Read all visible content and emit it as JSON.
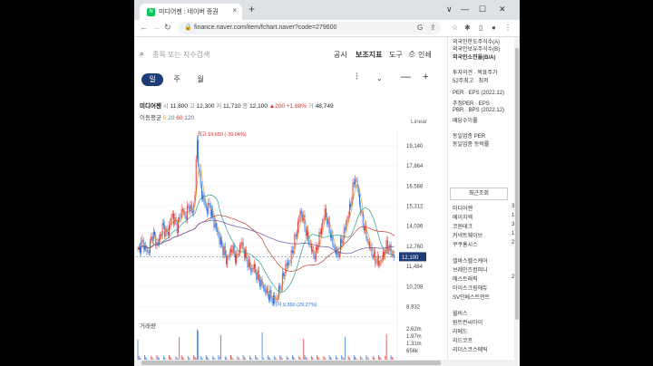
{
  "browser": {
    "tab_title": "미디어젠 : 네이버 증권",
    "tab_favicon": "N",
    "tab_close": "×",
    "new_tab": "+",
    "url": "finance.naver.com/item/fchart.naver?code=279600",
    "window_controls": [
      "∨",
      "—",
      "☐",
      "✕"
    ]
  },
  "search": {
    "placeholder": "종목 또는 지수검색"
  },
  "top_menu": [
    "공시",
    "보조지표",
    "도구",
    "인쇄"
  ],
  "periods": [
    "일",
    "주",
    "월"
  ],
  "stock": {
    "name": "미디어젠",
    "open_label": "시",
    "open": "11,800",
    "high_label": "고",
    "high": "12,300",
    "low_label": "저",
    "low": "11,710",
    "close_label": "종",
    "close": "12,100",
    "change": "▲200 +1.68%",
    "volume_label": "거",
    "volume": "48,749"
  },
  "moving_average": {
    "label": "이동평균",
    "periods": [
      "5",
      "20",
      "60",
      "120"
    ]
  },
  "scale_mode": "Linear",
  "chart_data": {
    "type": "candlestick",
    "price_axis_ticks": [
      "19,140",
      "17,864",
      "16,588",
      "15,312",
      "14,036",
      "12,760",
      "11,484",
      "10,208",
      "8,932"
    ],
    "current_price_tag": "12,100",
    "high_annotation": "최고 19,650 (-39.04%)",
    "low_annotation": "최저 9,360 (29.27%)",
    "volume_label": "거래량",
    "volume_axis_ticks": [
      "2.62m",
      "1.97m",
      "1.31m",
      "656k"
    ],
    "x_ticks": [
      "6월",
      "8월",
      "2022",
      "4월",
      "8월",
      "2023",
      "4월"
    ],
    "ylim": [
      8500,
      20000
    ],
    "price_path": [
      12400,
      12800,
      13000,
      12600,
      12300,
      12900,
      13600,
      13200,
      12800,
      13400,
      14000,
      13800,
      13500,
      14200,
      14800,
      14300,
      14000,
      14600,
      15200,
      14600,
      15000,
      15400,
      14800,
      15600,
      19650,
      17000,
      16000,
      15500,
      15000,
      15400,
      14800,
      14200,
      13800,
      13200,
      12800,
      12400,
      11800,
      12200,
      12700,
      12300,
      11900,
      12600,
      13000,
      12400,
      12000,
      11600,
      11200,
      11500,
      11000,
      10700,
      10400,
      10100,
      9900,
      9700,
      9500,
      9400,
      9360,
      9800,
      10300,
      10900,
      11500,
      11700,
      12000,
      12700,
      13400,
      14200,
      15000,
      14500,
      13800,
      13200,
      12700,
      12300,
      12100,
      13000,
      13600,
      14400,
      15000,
      14200,
      13600,
      12900,
      12500,
      12100,
      12700,
      13300,
      13900,
      14600,
      15200,
      16200,
      17200,
      16500,
      15400,
      14400,
      13800,
      13200,
      12700,
      12300,
      12000,
      11800,
      11700,
      12000,
      12400,
      12800,
      12600,
      12300,
      12100
    ]
  },
  "sidebar": {
    "info_rows": [
      "외국인한도주식수(A)",
      "외국인보유주식수(B)",
      "외국인소진율(B/A)"
    ],
    "target_rows": [
      "투자의견 · 목표주가",
      "52주최고 · 최저"
    ],
    "per_rows": [
      "PER · EPS (2022.12)",
      "추정PER · EPS",
      "PBR · BPS (2022.12)",
      "배당수익률"
    ],
    "industry_rows": [
      "동일업종 PER",
      "동일업종 등락률"
    ],
    "recent_tab": "최근조회",
    "recent_items": [
      {
        "name": "미디어젠",
        "num": "3"
      },
      {
        "name": "에이치엑",
        "num": "1"
      },
      {
        "name": "코윈테크",
        "num": "3"
      },
      {
        "name": "커넥트웨이브",
        "num": "1"
      },
      {
        "name": "쿠쿠홈시스",
        "num": "2"
      }
    ],
    "related_items": [
      {
        "name": "셀바스헬스케어",
        "num": ""
      },
      {
        "name": "브레인즈컴퍼니",
        "num": ""
      },
      {
        "name": "에스트래픽",
        "num": "2"
      },
      {
        "name": "아이스크림에듀",
        "num": ""
      },
      {
        "name": "SV인베스트먼트",
        "num": ""
      }
    ],
    "more_items": [
      "윌비스",
      "원트런씨아이",
      "라메드",
      "리드코프",
      "리더스코스메틱"
    ]
  },
  "colors": {
    "up": "#e22222",
    "down": "#1f6fe0",
    "ma5": "#e8a13b",
    "ma20": "#2a9d8f",
    "ma60": "#c0392b",
    "ma120": "#6c4fa3",
    "accent": "#1e3c78"
  }
}
